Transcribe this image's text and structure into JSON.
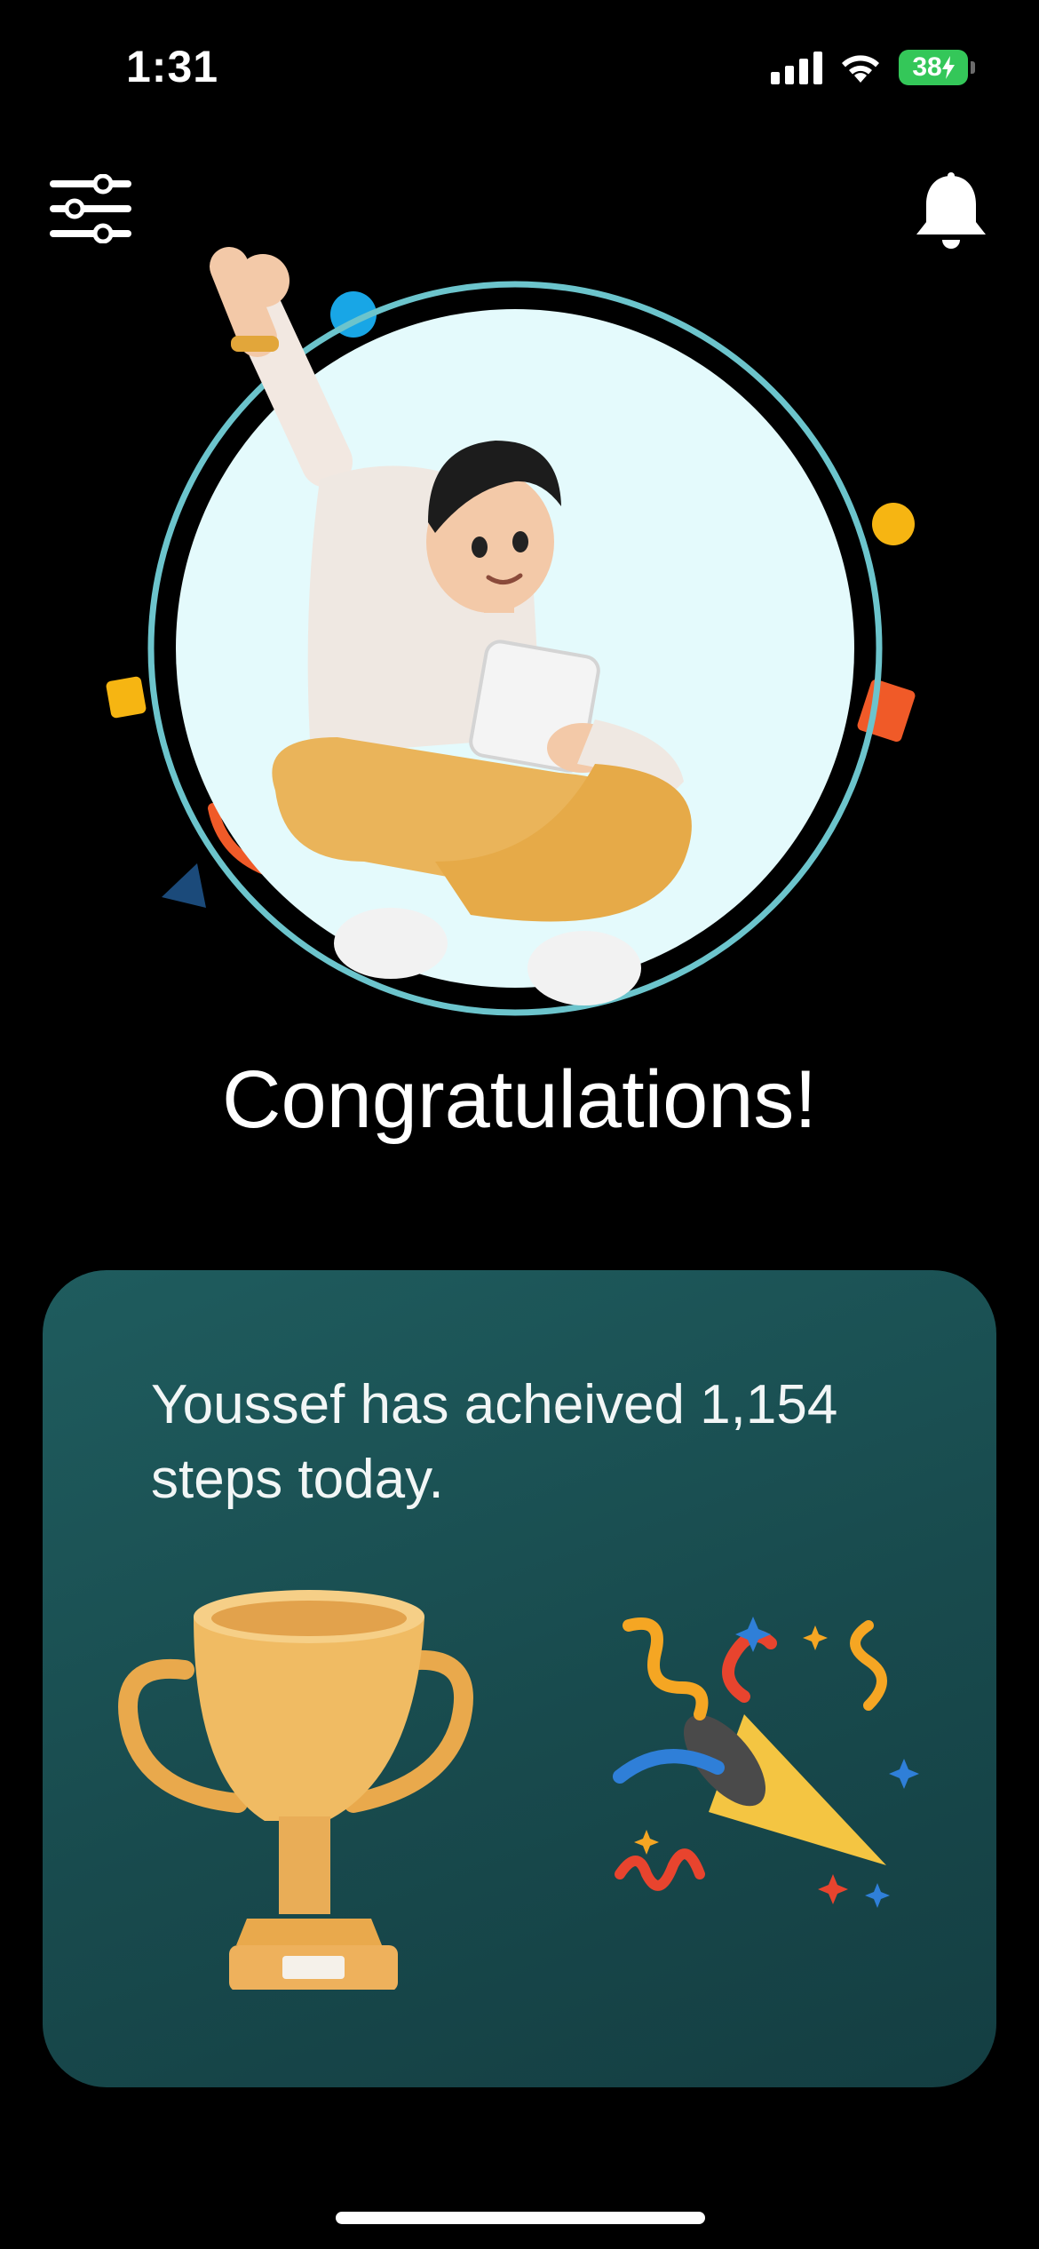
{
  "status_bar": {
    "time": "1:31",
    "battery_level": "38"
  },
  "header": {
    "filter_icon": "sliders-icon",
    "notification_icon": "bell-icon"
  },
  "hero": {
    "illustration": "person-celebrating-with-tablet",
    "ring_color": "#6cc4cc",
    "circle_fill": "#e4fafc"
  },
  "title": "Congratulations!",
  "achievement_card": {
    "message": "Youssef has acheived 1,154 steps today.",
    "trophy_icon": "trophy-icon",
    "party_icon": "party-popper-icon",
    "background": "#1a4f52"
  },
  "colors": {
    "background": "#000000",
    "text": "#ffffff",
    "battery": "#34c759"
  }
}
